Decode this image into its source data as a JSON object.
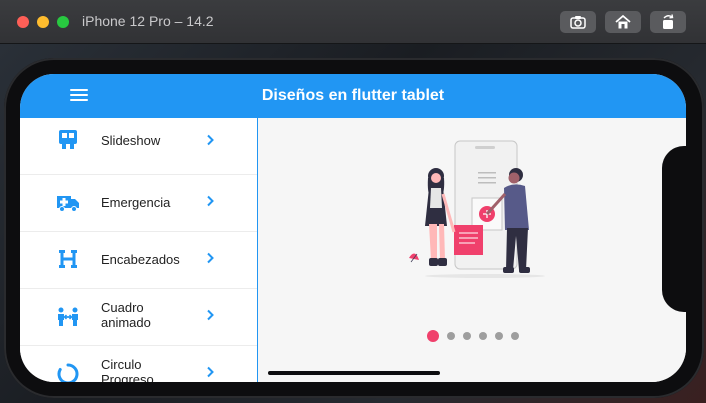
{
  "window": {
    "title": "iPhone 12 Pro – 14.2",
    "toolbar_icons": [
      "screenshot-icon",
      "home-icon",
      "rotate-icon"
    ]
  },
  "app": {
    "title": "Diseños en flutter tablet",
    "accent_color": "#2196f3",
    "menu_icon": "menu-icon"
  },
  "sidebar": {
    "items": [
      {
        "label": "Slideshow",
        "icon": "slideshow-icon"
      },
      {
        "label": "Emergencia",
        "icon": "ambulance-icon"
      },
      {
        "label": "Encabezados",
        "icon": "heading-icon"
      },
      {
        "label": "Cuadro animado",
        "icon": "people-arrows-icon"
      },
      {
        "label": "Circulo Progreso",
        "icon": "circle-progress-icon"
      }
    ]
  },
  "slideshow": {
    "illustration": "people-with-phone-illustration",
    "current_slide": 1,
    "total_slides": 6,
    "active_dot_color": "#f0406c",
    "inactive_dot_color": "#9e9e9e"
  }
}
